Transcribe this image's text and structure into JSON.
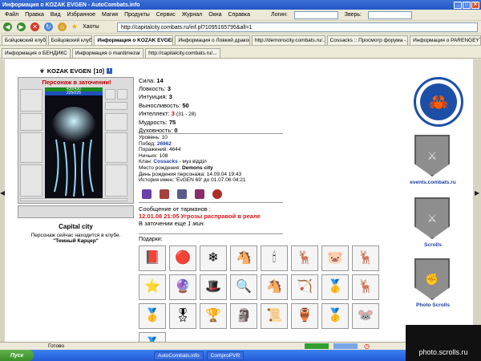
{
  "window": {
    "title": "Информация о KOZAK EVGEN - AutoCombats.info"
  },
  "menu": {
    "items": [
      "Файл",
      "Правка",
      "Вид",
      "Избранное",
      "Магия",
      "Продукты",
      "Сервис",
      "Журнал",
      "Окна",
      "Справка"
    ],
    "login_label": "Логин:",
    "animal_label": "Зверь:"
  },
  "nav": {
    "favorites_label": "Хаоты",
    "address": "http://capitalcity.combats.ru/inf.pl?1095165795&all=1"
  },
  "tabs_row1": [
    {
      "label": "Бойцовский клуб"
    },
    {
      "label": "Бойцовский клуб"
    },
    {
      "label": "Информация о KOZAK EVGEN",
      "active": true
    },
    {
      "label": "Информация о Ловкий дракон"
    },
    {
      "label": "http://demonscity.combats.ru/..."
    },
    {
      "label": "Cossacks :: Просмотр форума -..."
    },
    {
      "label": "Информация о PARENGEYT"
    }
  ],
  "tabs_row2": [
    {
      "label": "Информация о БЕНДИКС"
    },
    {
      "label": "Информация о mardimezar"
    },
    {
      "label": "http://capitalcity.combats.ru/..."
    }
  ],
  "character": {
    "name": "KOZAK EVGEN",
    "level": "[10]",
    "status": "Персонаж в заточении!",
    "hp": "430/430",
    "mana": "225/225",
    "location": "Capital city",
    "location_note": "Персонаж сейчас находится в клубе.",
    "location_room": "\"Темный Карцер\""
  },
  "stats": [
    {
      "label": "Сила:",
      "value": "14"
    },
    {
      "label": "Ловкость:",
      "value": "3"
    },
    {
      "label": "Интуиция:",
      "value": "3"
    },
    {
      "label": "Выносливость:",
      "value": "50"
    },
    {
      "label": "Интеллект:",
      "value": "3",
      "extra": "(31 - 28)"
    },
    {
      "label": "Мудрость:",
      "value": "75"
    },
    {
      "label": "Духовность:",
      "value": "0"
    }
  ],
  "info": {
    "level": "Уровень: 10",
    "wins_label": "Побед: ",
    "wins": "26962",
    "losses": "Поражений: 4644",
    "draws": "Ничьих: 108",
    "clan_label": "Клан: ",
    "clan": "Cossacks",
    "clan_rank": " - муз відділ",
    "birthplace_label": "Место рождения: ",
    "birthplace": "Demons city",
    "birthday": "День рождения персонажа: 14.09.04 19:43",
    "name_history": "История имен: 'EvGEN 69' до 01.07.06 04:21"
  },
  "message": {
    "header": "Сообщение от тарманов :",
    "line": "12.01.08 21:05 Угрозы расправой в реале",
    "jail_prefix": "В заточении еще ",
    "jail_time": "1 мин."
  },
  "gifts": {
    "label": "Подарки:",
    "items": [
      "📕",
      "🔴",
      "❄",
      "🐴",
      "🕯",
      "🦌",
      "🐷",
      "🦌",
      "⭐",
      "🔮",
      "🎩",
      "🔍",
      "🐴",
      "🏹",
      "🥇",
      "🦌",
      "🥇",
      "🎖",
      "🏆",
      "🗿",
      "📜",
      "🏺",
      "🥇",
      "🐭",
      "🏅"
    ]
  },
  "sidebar": {
    "events_caption": "events.combats.ru",
    "scrolls_caption": "Scrolls",
    "photo_caption": "Photo Scrolls"
  },
  "statusbar": {
    "text": "Готово"
  },
  "taskbar": {
    "start": "Пуск",
    "item1": "AutoCombats.info",
    "item2": "ComproPVR"
  },
  "watermark": "photo.scrolls.ru"
}
